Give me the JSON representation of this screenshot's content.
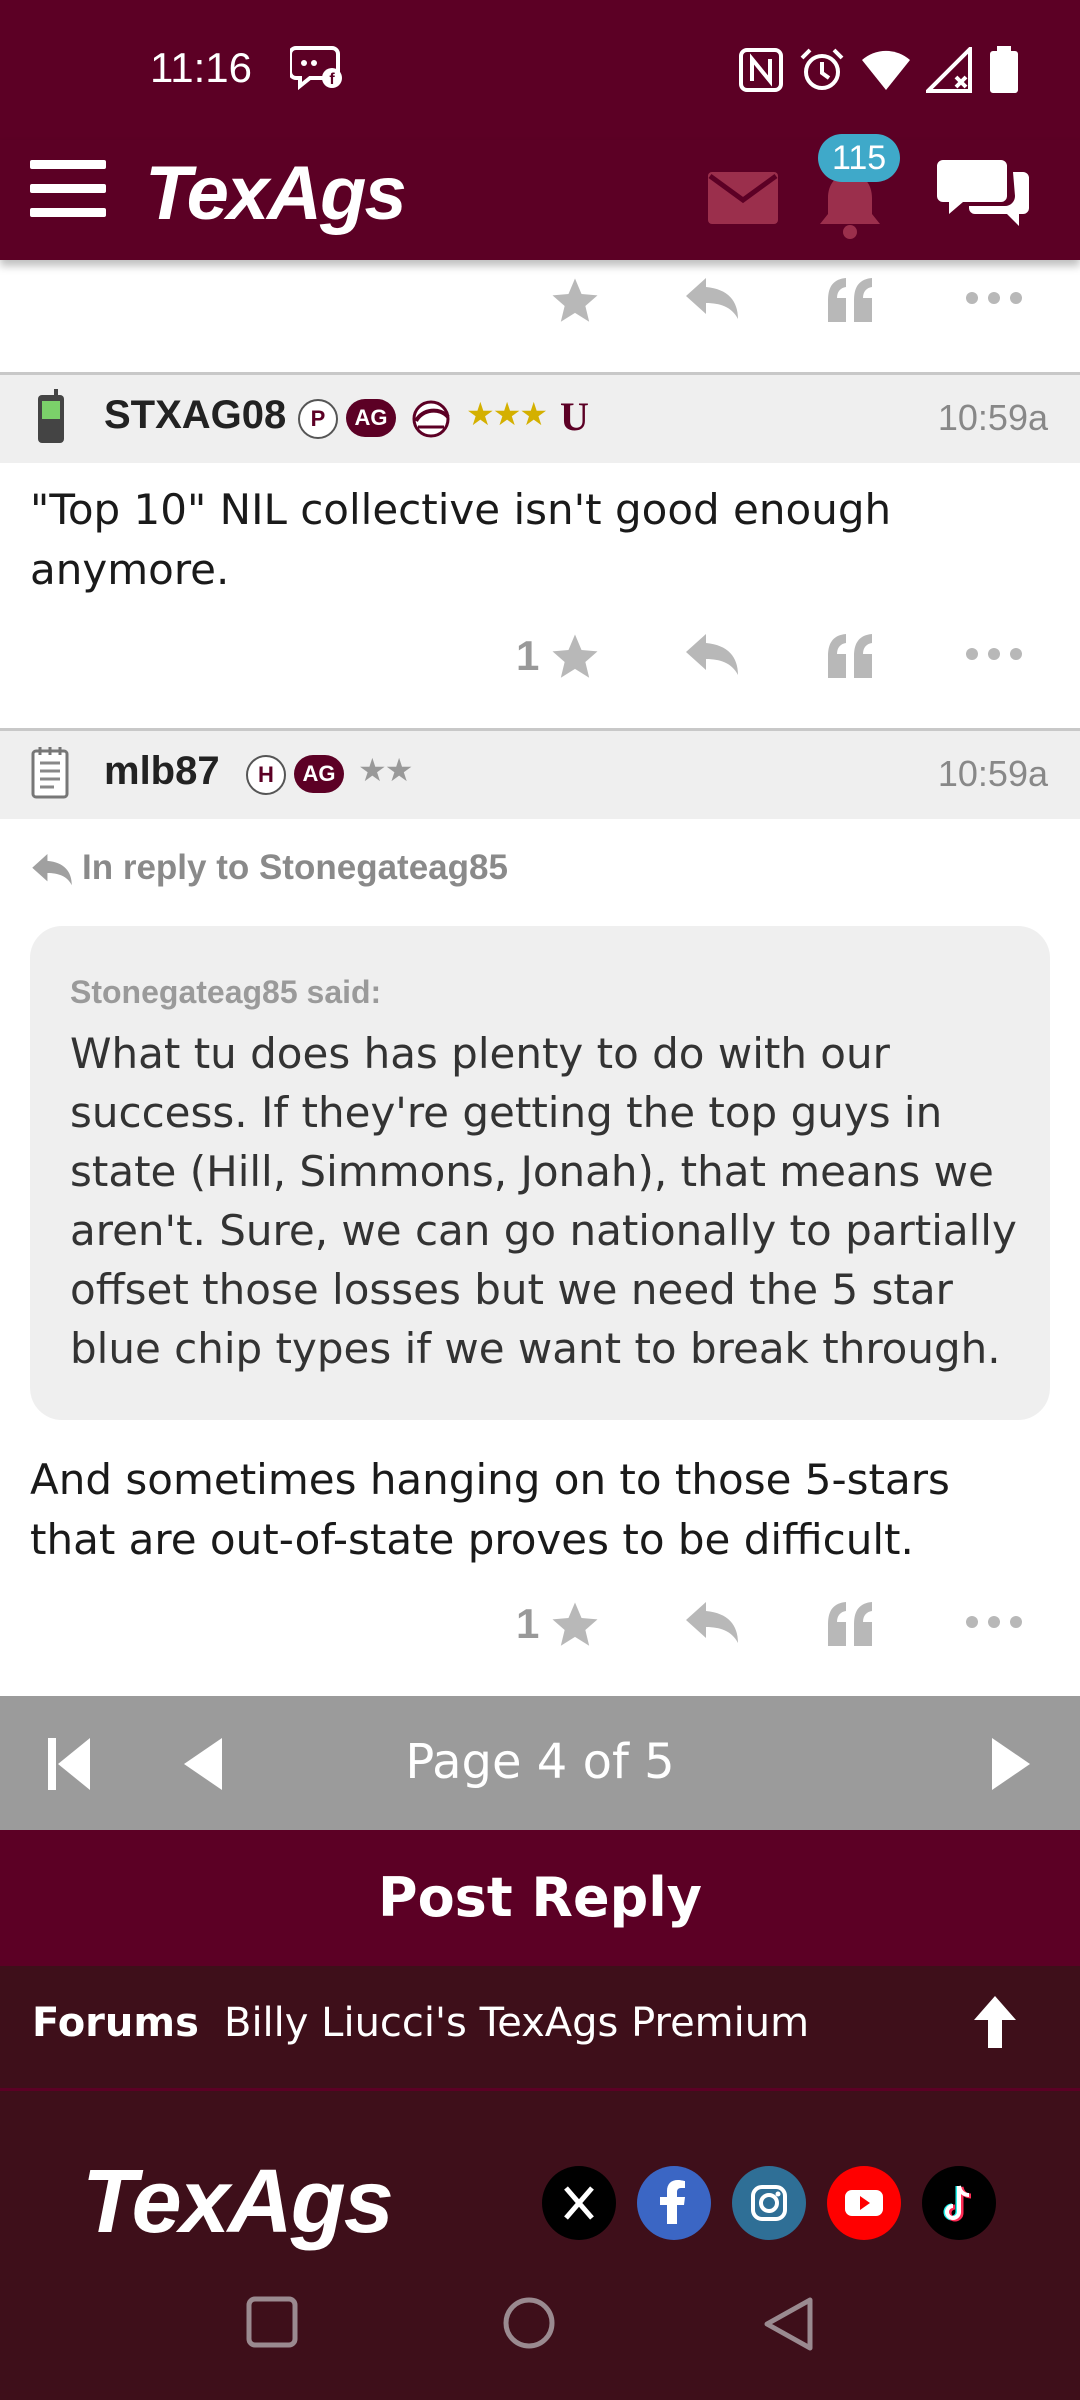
{
  "status_bar": {
    "time": "11:16"
  },
  "app": {
    "logo": "TexAgs",
    "notifications_count": "115"
  },
  "posts": [
    {
      "username": "STXAG08",
      "time": "10:59a",
      "body": "\"Top 10\" NIL collective isn't good enough anymore.",
      "stars_count": "1"
    },
    {
      "username": "mlb87",
      "time": "10:59a",
      "reply_to": "In reply to Stonegateag85",
      "quote_author": "Stonegateag85 said:",
      "quote_text": "What tu does has plenty to do with our success. If they're getting the top guys in state (Hill, Simmons, Jonah), that means we aren't. Sure, we can go nationally to partially offset those losses but we need the 5 star blue chip types if we want to break through.",
      "body": "And sometimes hanging on to those 5-stars that are out-of-state proves to be difficult.",
      "stars_count": "1"
    }
  ],
  "pager": {
    "label": "Page 4 of 5"
  },
  "post_reply_label": "Post Reply",
  "breadcrumb": {
    "forums": "Forums",
    "current": "Billy Liucci's TexAgs Premium"
  },
  "footer": {
    "logo": "TexAgs"
  },
  "colors": {
    "maroon": "#5c0025",
    "dark_maroon": "#3e0f1a",
    "badge_blue": "#3fa9c9",
    "gold": "#d4b000"
  }
}
